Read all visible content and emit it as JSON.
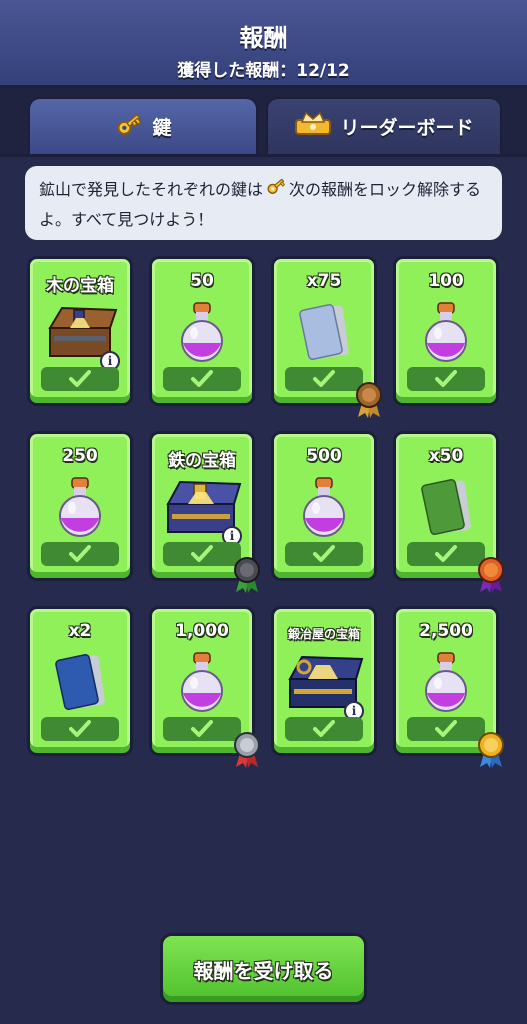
{
  "header": {
    "title": "報酬",
    "subtitle": "獲得した報酬：12/12"
  },
  "tabs": [
    {
      "label": "鍵",
      "icon": "key-icon",
      "active": true
    },
    {
      "label": "リーダーボード",
      "icon": "crown-icon",
      "active": false
    }
  ],
  "info": {
    "text_before": "鉱山で発見したそれぞれの鍵は",
    "text_after": "次の報酬をロック解除するよ。すべて見つけよう！"
  },
  "rewards": [
    {
      "label": "木の宝箱",
      "item": "wooden-chest",
      "claimed": true,
      "info": true
    },
    {
      "label": "50",
      "item": "elixir-potion",
      "claimed": true
    },
    {
      "label": "x75",
      "item": "card-pack-blue-grey",
      "claimed": true,
      "medal": "bronze"
    },
    {
      "label": "100",
      "item": "elixir-potion",
      "claimed": true
    },
    {
      "label": "250",
      "item": "elixir-potion",
      "claimed": true
    },
    {
      "label": "鉄の宝箱",
      "item": "iron-chest",
      "claimed": true,
      "info": true,
      "medal": "dark-silver"
    },
    {
      "label": "500",
      "item": "elixir-potion",
      "claimed": true
    },
    {
      "label": "x50",
      "item": "card-pack-green",
      "claimed": true,
      "medal": "orange"
    },
    {
      "label": "x2",
      "item": "card-pack-blue",
      "claimed": true
    },
    {
      "label": "1,000",
      "item": "elixir-potion",
      "claimed": true,
      "medal": "silver"
    },
    {
      "label": "鍛冶屋の宝箱",
      "item": "blacksmith-chest",
      "claimed": true,
      "info": true
    },
    {
      "label": "2,500",
      "item": "elixir-potion",
      "claimed": true,
      "medal": "gold"
    }
  ],
  "claim_button": {
    "label": "報酬を受け取る"
  },
  "colors": {
    "background": "#262a4d",
    "header": "#4a5794",
    "card_green": "#8ff05a",
    "check_bar": "#3f8a32"
  }
}
